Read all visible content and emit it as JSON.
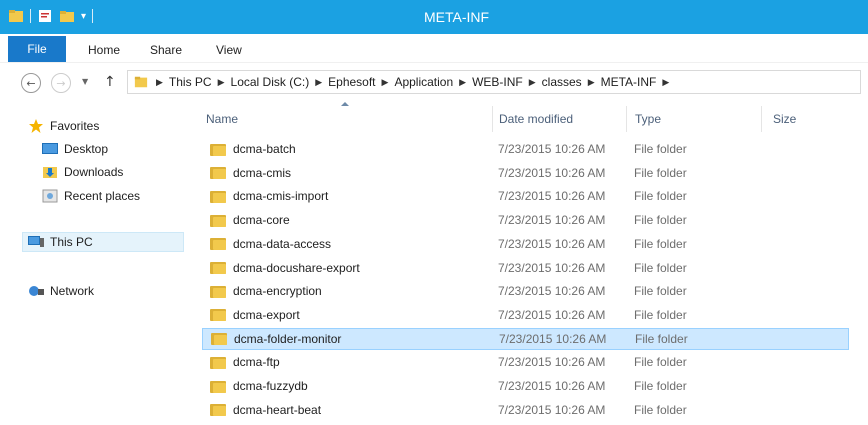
{
  "window": {
    "title": "META-INF"
  },
  "ribbon": {
    "tabs": [
      "File",
      "Home",
      "Share",
      "View"
    ]
  },
  "address": {
    "crumbs": [
      "This PC",
      "Local Disk (C:)",
      "Ephesoft",
      "Application",
      "WEB-INF",
      "classes",
      "META-INF"
    ]
  },
  "nav": {
    "favorites": "Favorites",
    "desktop": "Desktop",
    "downloads": "Downloads",
    "recent": "Recent places",
    "thispc": "This PC",
    "network": "Network"
  },
  "columns": {
    "name": "Name",
    "date": "Date modified",
    "type": "Type",
    "size": "Size"
  },
  "files": [
    {
      "name": "dcma-batch",
      "date": "7/23/2015 10:26 AM",
      "type": "File folder"
    },
    {
      "name": "dcma-cmis",
      "date": "7/23/2015 10:26 AM",
      "type": "File folder"
    },
    {
      "name": "dcma-cmis-import",
      "date": "7/23/2015 10:26 AM",
      "type": "File folder"
    },
    {
      "name": "dcma-core",
      "date": "7/23/2015 10:26 AM",
      "type": "File folder"
    },
    {
      "name": "dcma-data-access",
      "date": "7/23/2015 10:26 AM",
      "type": "File folder"
    },
    {
      "name": "dcma-docushare-export",
      "date": "7/23/2015 10:26 AM",
      "type": "File folder"
    },
    {
      "name": "dcma-encryption",
      "date": "7/23/2015 10:26 AM",
      "type": "File folder"
    },
    {
      "name": "dcma-export",
      "date": "7/23/2015 10:26 AM",
      "type": "File folder"
    },
    {
      "name": "dcma-folder-monitor",
      "date": "7/23/2015 10:26 AM",
      "type": "File folder"
    },
    {
      "name": "dcma-ftp",
      "date": "7/23/2015 10:26 AM",
      "type": "File folder"
    },
    {
      "name": "dcma-fuzzydb",
      "date": "7/23/2015 10:26 AM",
      "type": "File folder"
    },
    {
      "name": "dcma-heart-beat",
      "date": "7/23/2015 10:26 AM",
      "type": "File folder"
    }
  ],
  "selected_index": 8,
  "colors": {
    "titlebar": "#1ba1e2",
    "file_tab": "#1979ca",
    "selection": "#cde8ff",
    "folder": "#f2c94c"
  }
}
